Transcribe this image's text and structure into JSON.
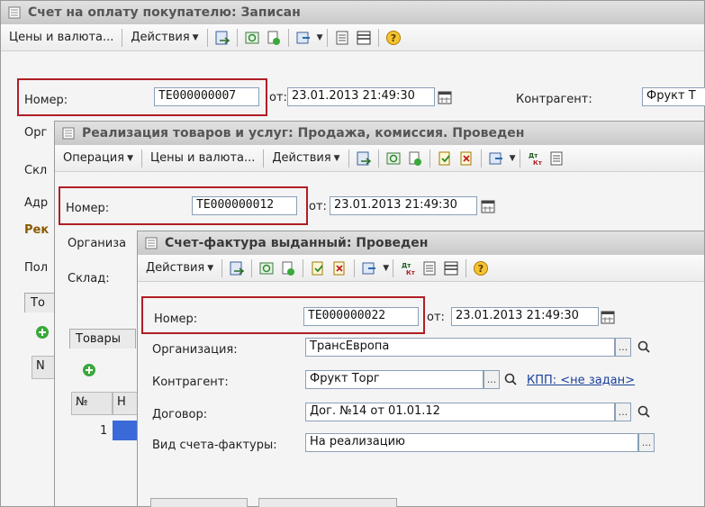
{
  "win1": {
    "title": "Счет на оплату покупателю: Записан",
    "toolbar": {
      "prices": "Цены и валюта...",
      "actions": "Действия"
    },
    "number_label": "Номер:",
    "number_value": "ТЕ000000007",
    "date_label": "от:",
    "date_value": "23.01.2013 21:49:30",
    "counterparty_label": "Контрагент:",
    "counterparty_value": "Фрукт Т",
    "side_labels": [
      "Орг",
      "Скл",
      "Адр",
      "Рек",
      "Пол"
    ],
    "tab_partial": "То",
    "grid_hdr_partial": "N"
  },
  "win2": {
    "title": "Реализация товаров и услуг: Продажа, комиссия. Проведен",
    "toolbar": {
      "operation": "Операция",
      "prices": "Цены и валюта...",
      "actions": "Действия"
    },
    "number_label": "Номер:",
    "number_value": "ТЕ000000012",
    "date_label": "от:",
    "date_value": "23.01.2013 21:49:30",
    "org_label_partial": "Организа",
    "warehouse_label": "Склад:",
    "tab_goods_partial": "Товары",
    "grid_col_num": "№",
    "grid_col_partial": "Н",
    "grid_row_num": "1"
  },
  "win3": {
    "title": "Счет-фактура выданный: Проведен",
    "toolbar": {
      "actions": "Действия"
    },
    "number_label": "Номер:",
    "number_value": "ТЕ000000022",
    "date_label": "от:",
    "date_value": "23.01.2013 21:49:30",
    "org_label": "Организация:",
    "org_value": "ТрансЕвропа",
    "counterparty_label": "Контрагент:",
    "counterparty_value": "Фрукт Торг",
    "kpp_link": "КПП: <не задан>",
    "contract_label": "Договор:",
    "contract_value": "Дог. №14 от 01.01.12",
    "invoice_type_label": "Вид счета-фактуры:",
    "invoice_type_value": "На реализацию"
  },
  "colors": {
    "highlight": "#b01e24",
    "link": "#1a3f9a",
    "field_border": "#8aa0b8"
  }
}
